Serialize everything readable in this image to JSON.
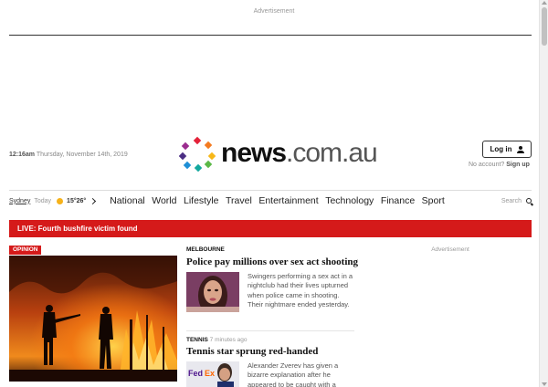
{
  "ads": {
    "top_label": "Advertisement",
    "side_label": "Advertisement"
  },
  "header": {
    "time": "12:16am",
    "date": "Thursday, November 14th, 2019",
    "logo": {
      "news": "news",
      "domain": ".com.au"
    },
    "login_label": "Log in",
    "no_account_text": "No account?",
    "signup_label": "Sign up"
  },
  "nav": {
    "weather": {
      "city": "Sydney",
      "day": "Today",
      "temps": "15°26°"
    },
    "items": [
      "National",
      "World",
      "Lifestyle",
      "Travel",
      "Entertainment",
      "Technology",
      "Finance",
      "Sport"
    ],
    "search_label": "Search"
  },
  "live_banner": "LIVE: Fourth bushfire victim found",
  "hero": {
    "badge": "OPINION"
  },
  "stories": [
    {
      "section": "MELBOURNE",
      "time": "",
      "headline": "Police pay millions over sex act shooting",
      "standfirst": "Swingers performing a sex act in a nightclub had their lives upturned when police came in shooting. Their nightmare ended yesterday."
    },
    {
      "section": "TENNIS",
      "time": "7 minutes ago",
      "headline": "Tennis star sprung red-handed",
      "standfirst": "Alexander Zverev has given a bizarre explanation after he appeared to be caught with a"
    }
  ],
  "colors": {
    "brand_red": "#d51a1a",
    "weather_sun": "#f6b21a"
  }
}
